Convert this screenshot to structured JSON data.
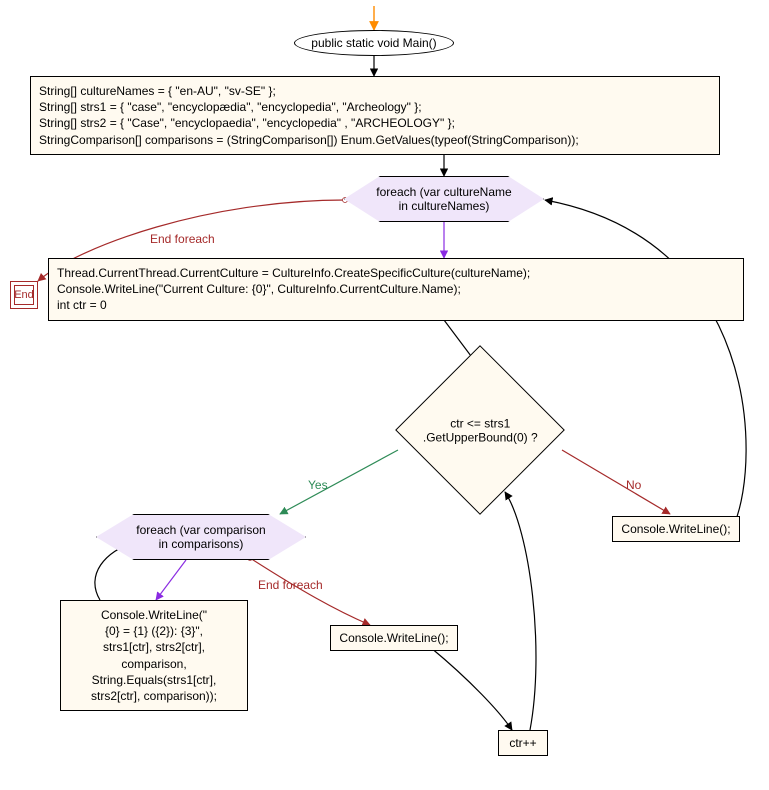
{
  "chart_data": {
    "type": "flowchart",
    "nodes": [
      {
        "id": "start",
        "shape": "entry-arrow"
      },
      {
        "id": "main",
        "shape": "ellipse",
        "text": "public static void Main()"
      },
      {
        "id": "decl",
        "shape": "rect",
        "text": "String[] cultureNames = { \"en-AU\", \"sv-SE\" };\nString[] strs1 = { \"case\", \"encyclopædia\", \"encyclopedia\", \"Archeology\" };\nString[] strs2 = { \"Case\", \"encyclopaedia\", \"encyclopedia\" , \"ARCHEOLOGY\" };\nStringComparison[] comparisons = (StringComparison[]) Enum.GetValues(typeof(StringComparison));"
      },
      {
        "id": "foreach1",
        "shape": "hexagon",
        "text": "foreach (var cultureName\nin cultureNames)"
      },
      {
        "id": "end",
        "shape": "terminator",
        "text": "End"
      },
      {
        "id": "body1",
        "shape": "rect",
        "text": "Thread.CurrentThread.CurrentCulture = CultureInfo.CreateSpecificCulture(cultureName);\nConsole.WriteLine(\"Current Culture: {0}\", CultureInfo.CurrentCulture.Name);\nint ctr = 0"
      },
      {
        "id": "cond",
        "shape": "diamond",
        "text": "ctr <= strs1\n.GetUpperBound(0) ?"
      },
      {
        "id": "cwEmpty1",
        "shape": "rect",
        "text": "Console.WriteLine();"
      },
      {
        "id": "foreach2",
        "shape": "hexagon",
        "text": "foreach (var comparison\nin comparisons)"
      },
      {
        "id": "writeCmp",
        "shape": "rect",
        "text": "Console.WriteLine(\"\n{0} = {1} ({2}): {3}\",\nstrs1[ctr], strs2[ctr],\ncomparison,\nString.Equals(strs1[ctr],\nstrs2[ctr], comparison));"
      },
      {
        "id": "cwEmpty2",
        "shape": "rect",
        "text": "Console.WriteLine();"
      },
      {
        "id": "ctrpp",
        "shape": "rect",
        "text": "ctr++"
      }
    ],
    "edges": [
      {
        "from": "start",
        "to": "main",
        "color": "#ff8c00"
      },
      {
        "from": "main",
        "to": "decl"
      },
      {
        "from": "decl",
        "to": "foreach1"
      },
      {
        "from": "foreach1",
        "to": "end",
        "label": "End foreach",
        "color": "#a52a2a"
      },
      {
        "from": "foreach1",
        "to": "body1",
        "color": "#8a2be2"
      },
      {
        "from": "body1",
        "to": "cond"
      },
      {
        "from": "cond",
        "to": "foreach2",
        "label": "Yes",
        "color": "#2e8b57"
      },
      {
        "from": "cond",
        "to": "cwEmpty1",
        "label": "No",
        "color": "#a52a2a"
      },
      {
        "from": "cwEmpty1",
        "to": "foreach1"
      },
      {
        "from": "foreach2",
        "to": "writeCmp",
        "color": "#8a2be2"
      },
      {
        "from": "writeCmp",
        "to": "foreach2"
      },
      {
        "from": "foreach2",
        "to": "cwEmpty2",
        "label": "End foreach",
        "color": "#a52a2a"
      },
      {
        "from": "cwEmpty2",
        "to": "ctrpp"
      },
      {
        "from": "ctrpp",
        "to": "cond"
      }
    ],
    "edge_labels": {
      "end_foreach": "End foreach",
      "yes": "Yes",
      "no": "No"
    }
  },
  "end_label": "End"
}
